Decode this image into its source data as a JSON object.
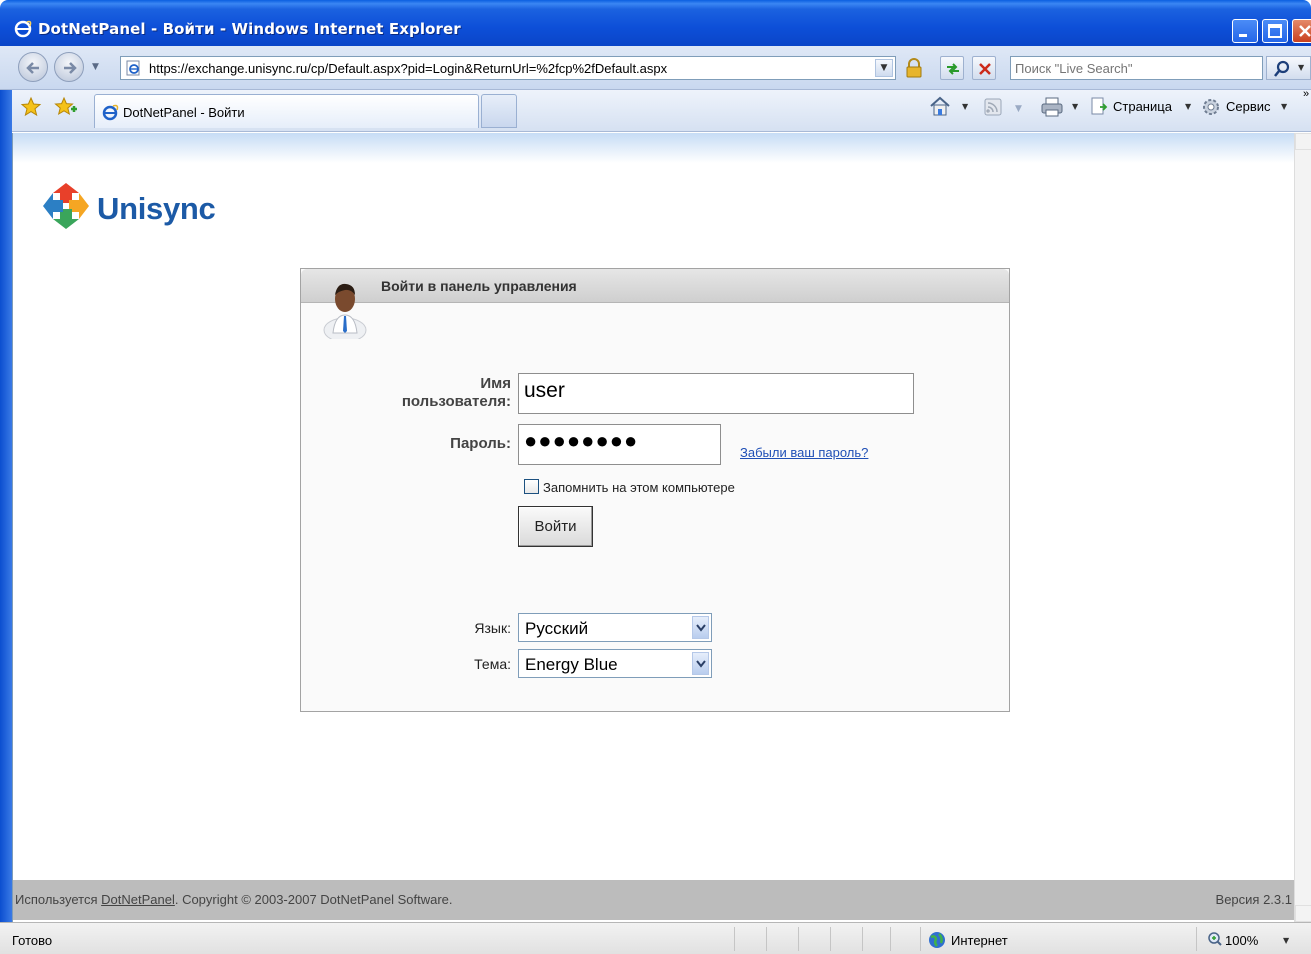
{
  "window": {
    "title": "DotNetPanel - Войти - Windows Internet Explorer"
  },
  "address_bar": {
    "url": "https://exchange.unisync.ru/cp/Default.aspx?pid=Login&ReturnUrl=%2fcp%2fDefault.aspx",
    "search_placeholder": "Поиск \"Live Search\""
  },
  "tabs": [
    {
      "label": "DotNetPanel - Войти",
      "active": true
    }
  ],
  "toolbar": {
    "page_label": "Страница",
    "tools_label": "Сервис"
  },
  "page": {
    "logo_text": "Unisync",
    "login": {
      "title": "Войти в панель управления",
      "username_label_line1": "Имя",
      "username_label_line2": "пользователя:",
      "username_value": "user",
      "password_label": "Пароль:",
      "password_masked": "●●●●●●●●",
      "forgot_link": "Забыли ваш пароль?",
      "remember_label": "Запомнить на этом компьютере",
      "remember_checked": false,
      "submit_label": "Войти",
      "language_label": "Язык:",
      "language_value": "Русский",
      "theme_label": "Тема:",
      "theme_value": "Energy Blue"
    },
    "footer": {
      "prefix": "Используется ",
      "link": "DotNetPanel",
      "suffix": ". Copyright © 2003-2007 DotNetPanel Software.",
      "version": "Версия 2.3.1"
    }
  },
  "status_bar": {
    "status_text": "Готово",
    "zone_label": "Интернет",
    "zoom_label": "100%"
  },
  "colors": {
    "titlebar": "#0d4fd8",
    "logo": "#1c5aa6",
    "link": "#1f4fb6",
    "footer_bg": "#bcbcbc"
  },
  "icons": [
    "ie-icon",
    "minimize-icon",
    "maximize-icon",
    "close-icon",
    "back-arrow-icon",
    "forward-arrow-icon",
    "page-icon",
    "lock-icon",
    "refresh-icon",
    "stop-icon",
    "search-icon",
    "favorites-star-icon",
    "add-favorites-icon",
    "home-icon",
    "feeds-icon",
    "print-icon",
    "page-menu-icon",
    "tools-gear-icon",
    "unisync-logo-icon",
    "user-avatar-icon",
    "globe-icon",
    "zoom-icon"
  ]
}
